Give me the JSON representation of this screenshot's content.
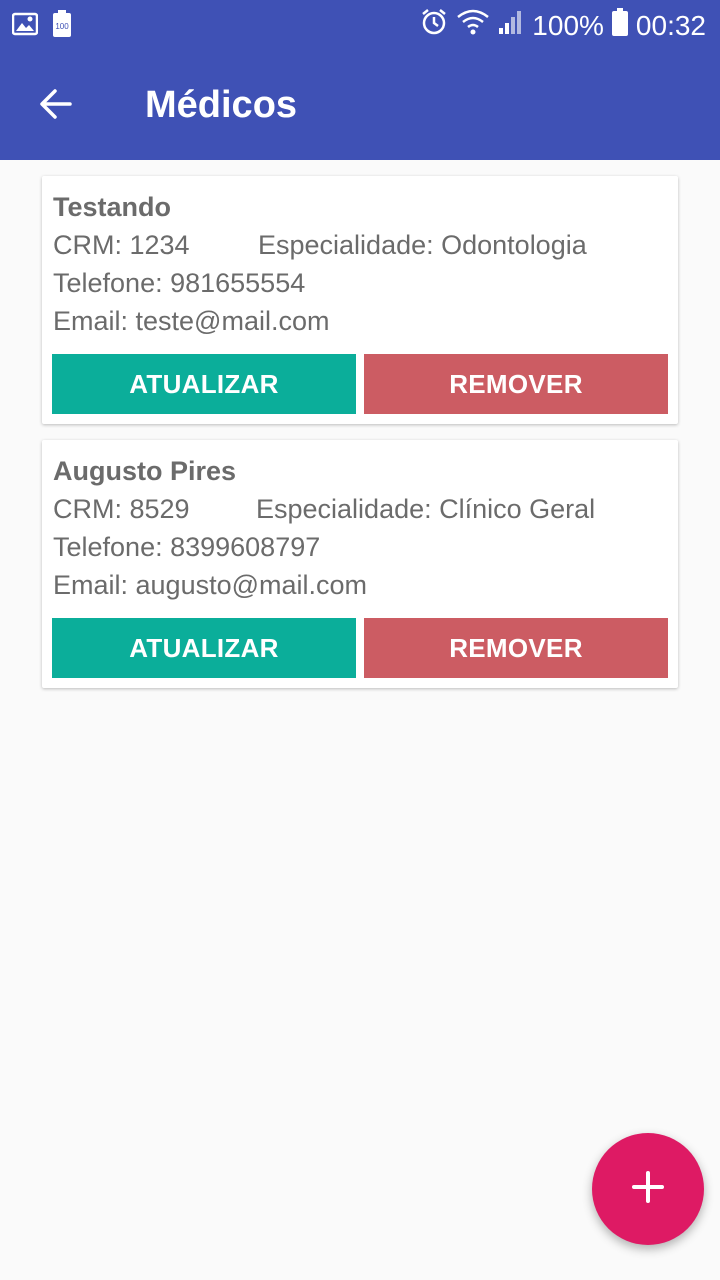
{
  "status_bar": {
    "battery_percent": "100%",
    "time": "00:32",
    "icons": [
      "gallery-icon",
      "battery-saver-icon",
      "alarm-icon",
      "wifi-icon",
      "signal-icon",
      "battery-icon"
    ]
  },
  "app_bar": {
    "title": "Médicos",
    "back_icon": "arrow-back-icon",
    "color": "#3f51b5"
  },
  "doctors": [
    {
      "name": "Testando",
      "crm": "CRM: 1234",
      "specialty": "Especialidade: Odontologia",
      "phone": "Telefone: 981655554",
      "email": "Email: teste@mail.com",
      "update_label": "ATUALIZAR",
      "remove_label": "REMOVER"
    },
    {
      "name": "Augusto Pires",
      "crm": "CRM: 8529",
      "specialty": "Especialidade: Clínico Geral",
      "phone": "Telefone: 8399608797",
      "email": "Email: augusto@mail.com",
      "update_label": "ATUALIZAR",
      "remove_label": "REMOVER"
    }
  ],
  "colors": {
    "update_button": "#0bae9a",
    "remove_button": "#cc5c63",
    "fab": "#de1a64"
  },
  "fab": {
    "icon": "plus-icon"
  }
}
